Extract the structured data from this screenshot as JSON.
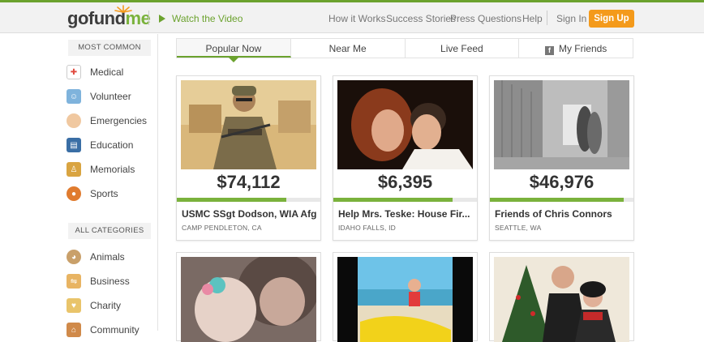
{
  "header": {
    "logo_go": "go",
    "logo_fund": "fund",
    "logo_me": "me",
    "watch_label": "Watch the Video",
    "nav": [
      "How it Works",
      "Success Stories",
      "Press",
      "Questions",
      "Help"
    ],
    "sign_in": "Sign In",
    "sign_up": "Sign Up"
  },
  "sidebar": {
    "most_common_label": "MOST COMMON",
    "most_common": [
      {
        "label": "Medical",
        "icon": "first-aid-icon",
        "color": "#e04a3f"
      },
      {
        "label": "Volunteer",
        "icon": "volunteer-icon",
        "color": "#4a90c2"
      },
      {
        "label": "Emergencies",
        "icon": "bandage-icon",
        "color": "#f0c8a0"
      },
      {
        "label": "Education",
        "icon": "book-icon",
        "color": "#3a6ea5"
      },
      {
        "label": "Memorials",
        "icon": "memorial-icon",
        "color": "#d9a441"
      },
      {
        "label": "Sports",
        "icon": "ball-icon",
        "color": "#e07b2e"
      }
    ],
    "all_categories_label": "ALL CATEGORIES",
    "all_categories": [
      {
        "label": "Animals",
        "icon": "dog-icon",
        "color": "#c9a06a"
      },
      {
        "label": "Business",
        "icon": "handshake-icon",
        "color": "#e8b463"
      },
      {
        "label": "Charity",
        "icon": "charity-icon",
        "color": "#e9c46a"
      },
      {
        "label": "Community",
        "icon": "community-icon",
        "color": "#d08a4a"
      }
    ]
  },
  "tabs": [
    {
      "label": "Popular Now",
      "active": true
    },
    {
      "label": "Near Me",
      "active": false
    },
    {
      "label": "Live Feed",
      "active": false
    },
    {
      "label": "My Friends",
      "active": false
    }
  ],
  "campaigns": [
    {
      "amount": "$74,112",
      "progress": 0.76,
      "title": "USMC SSgt Dodson, WIA Afg",
      "location": "CAMP PENDLETON, CA"
    },
    {
      "amount": "$6,395",
      "progress": 0.83,
      "title": "Help Mrs. Teske: House Fir...",
      "location": "IDAHO FALLS, ID"
    },
    {
      "amount": "$46,976",
      "progress": 0.93,
      "title": "Friends of Chris Connors",
      "location": "SEATTLE, WA"
    }
  ],
  "colors": {
    "accent": "#6ba22e",
    "signup": "#f49a1b"
  }
}
